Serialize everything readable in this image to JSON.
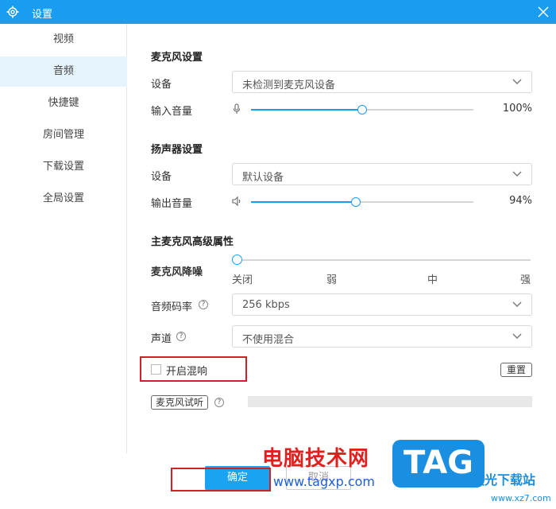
{
  "window": {
    "title": "设置"
  },
  "sidebar": {
    "items": [
      {
        "label": "视频",
        "active": false
      },
      {
        "label": "音频",
        "active": true
      },
      {
        "label": "快捷键",
        "active": false
      },
      {
        "label": "房间管理",
        "active": false
      },
      {
        "label": "下载设置",
        "active": false
      },
      {
        "label": "全局设置",
        "active": false
      }
    ]
  },
  "mic": {
    "section_title": "麦克风设置",
    "device_label": "设备",
    "device_value": "未检测到麦克风设备",
    "volume_label": "输入音量",
    "volume_value": "100%",
    "volume_fraction": 0.5
  },
  "speaker": {
    "section_title": "扬声器设置",
    "device_label": "设备",
    "device_value": "默认设备",
    "volume_label": "输出音量",
    "volume_value": "94%",
    "volume_fraction": 0.47
  },
  "advanced": {
    "section_title": "主麦克风高级属性",
    "noise_label": "麦克风降噪",
    "noise_ticks": [
      "关闭",
      "弱",
      "中",
      "强"
    ],
    "bitrate_label": "音频码率",
    "bitrate_value": "256 kbps",
    "channel_label": "声道",
    "channel_value": "不使用混合",
    "reverb_label": "开启混响",
    "reverb_checked": false,
    "reset_label": "重置",
    "mic_test_label": "麦克风试听"
  },
  "footer": {
    "confirm_label": "确定",
    "cancel_label": "取消"
  },
  "watermark": {
    "red_text": "电脑技术网",
    "url": "www.tagxp.com",
    "tag": "TAG",
    "site_name": "极光下载站",
    "site_url": "www.xz7.com"
  },
  "colors": {
    "accent": "#1a9cf0",
    "highlight": "#d2202a"
  }
}
